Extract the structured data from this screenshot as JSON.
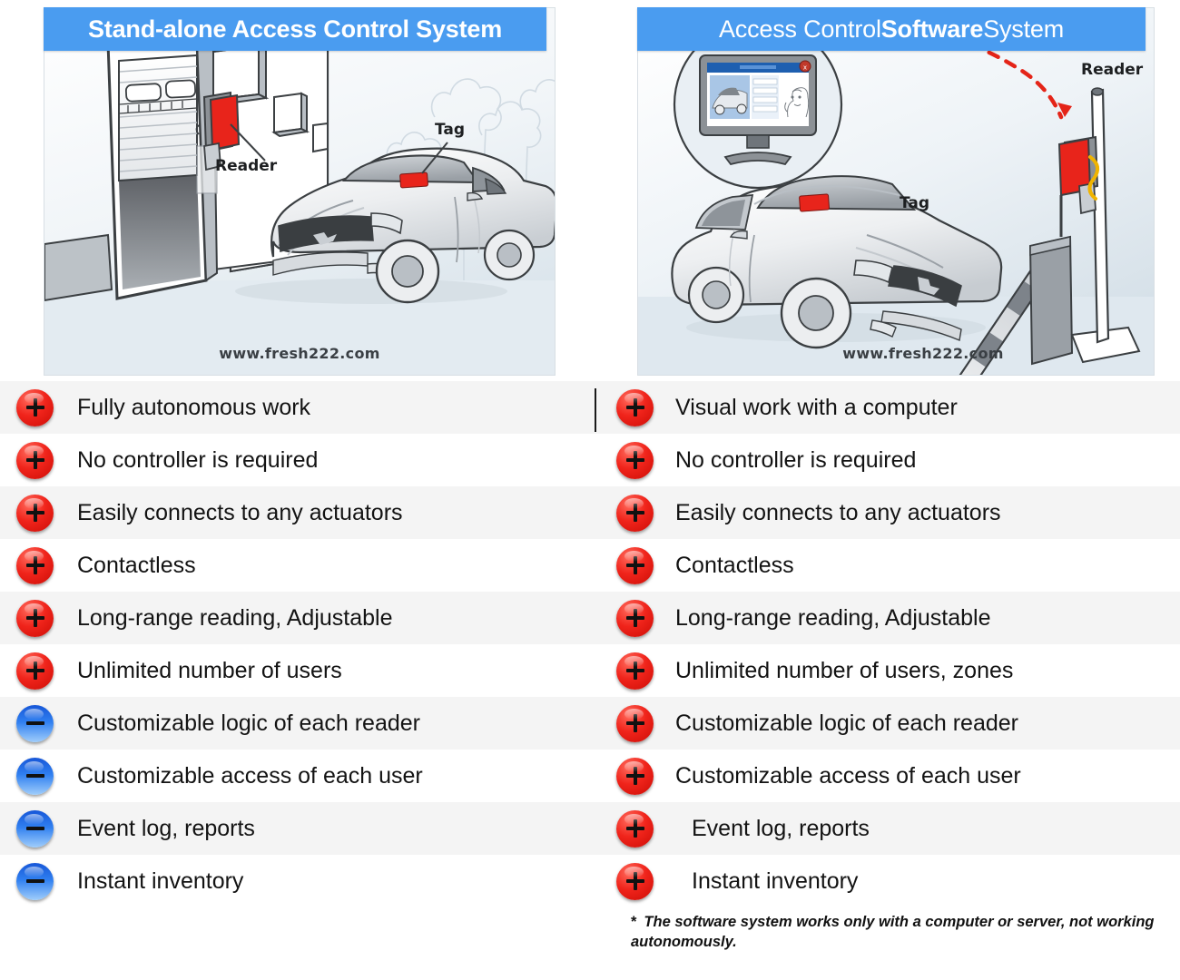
{
  "panels": {
    "left": {
      "title": "Stand-alone Access Control System",
      "title_plain": "Stand-alone Access Control System",
      "watermark": "www.fresh222.com",
      "labels": {
        "reader": "Reader",
        "tag": "Tag"
      }
    },
    "right": {
      "title_part1": "Access Control ",
      "title_part2": "Software",
      "title_part3": " System",
      "watermark": "www.fresh222.com",
      "labels": {
        "reader": "Reader",
        "tag": "Tag"
      }
    }
  },
  "colors": {
    "header_blue": "#4a9cf0",
    "plus_red": "#e8241b",
    "minus_blue": "#2f7ff0",
    "row_shade": "#f4f4f4",
    "tag_red": "#e8241b",
    "arrow_red": "#e42418"
  },
  "left_features": [
    {
      "icon": "plus-icon",
      "sign": "+",
      "label": "Fully autonomous work"
    },
    {
      "icon": "plus-icon",
      "sign": "+",
      "label": "No controller is required"
    },
    {
      "icon": "plus-icon",
      "sign": "+",
      "label": "Easily connects to any actuators"
    },
    {
      "icon": "plus-icon",
      "sign": "+",
      "label": "Contactless"
    },
    {
      "icon": "plus-icon",
      "sign": "+",
      "label": "Long-range reading, Adjustable"
    },
    {
      "icon": "plus-icon",
      "sign": "+",
      "label": "Unlimited number of users"
    },
    {
      "icon": "minus-icon",
      "sign": "−",
      "label": "Customizable logic of each reader"
    },
    {
      "icon": "minus-icon",
      "sign": "−",
      "label": "Customizable access of each user"
    },
    {
      "icon": "minus-icon",
      "sign": "−",
      "label": "Event log, reports"
    },
    {
      "icon": "minus-icon",
      "sign": "−",
      "label": "Instant inventory"
    }
  ],
  "right_features": [
    {
      "icon": "plus-icon",
      "sign": "+",
      "label": "Visual work with a computer"
    },
    {
      "icon": "plus-icon",
      "sign": "+",
      "label": "No controller is required"
    },
    {
      "icon": "plus-icon",
      "sign": "+",
      "label": "Easily connects to any actuators"
    },
    {
      "icon": "plus-icon",
      "sign": "+",
      "label": "Contactless"
    },
    {
      "icon": "plus-icon",
      "sign": "+",
      "label": "Long-range reading, Adjustable"
    },
    {
      "icon": "plus-icon",
      "sign": "+",
      "label": "Unlimited number of users, zones"
    },
    {
      "icon": "plus-icon",
      "sign": "+",
      "label": "Customizable logic of each reader"
    },
    {
      "icon": "plus-icon",
      "sign": "+",
      "label": "Customizable access of each user"
    },
    {
      "icon": "plus-icon",
      "sign": "+",
      "label": "Event log, reports"
    },
    {
      "icon": "plus-icon",
      "sign": "+",
      "label": "Instant inventory"
    }
  ],
  "footnote": {
    "marker": "*",
    "text": "The software system works only with a computer or server, not working autonomously."
  }
}
